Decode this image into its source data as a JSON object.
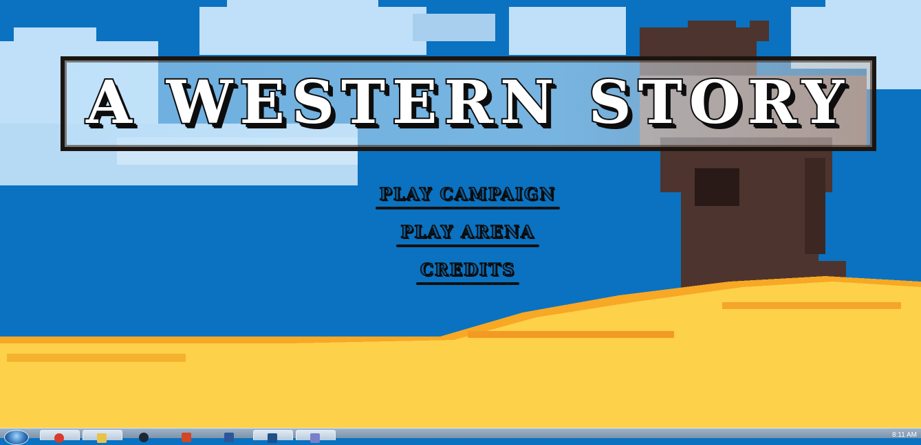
{
  "game": {
    "title": "A WESTERN STORY"
  },
  "menu": {
    "items": [
      {
        "label": "PLAY CAMPAIGN"
      },
      {
        "label": "PLAY ARENA"
      },
      {
        "label": "CREDITS"
      }
    ]
  },
  "taskbar": {
    "clock": "8:11 AM",
    "apps": [
      "start-icon",
      "chrome-icon",
      "explorer-icon",
      "steam-icon",
      "office-icon",
      "word-icon",
      "game-icon",
      "paint-icon"
    ]
  },
  "colors": {
    "sky": "#0a72c0",
    "sand": "#fdd14a",
    "tree_trunk": "#4e342e",
    "banner_border": "#1b1410"
  }
}
